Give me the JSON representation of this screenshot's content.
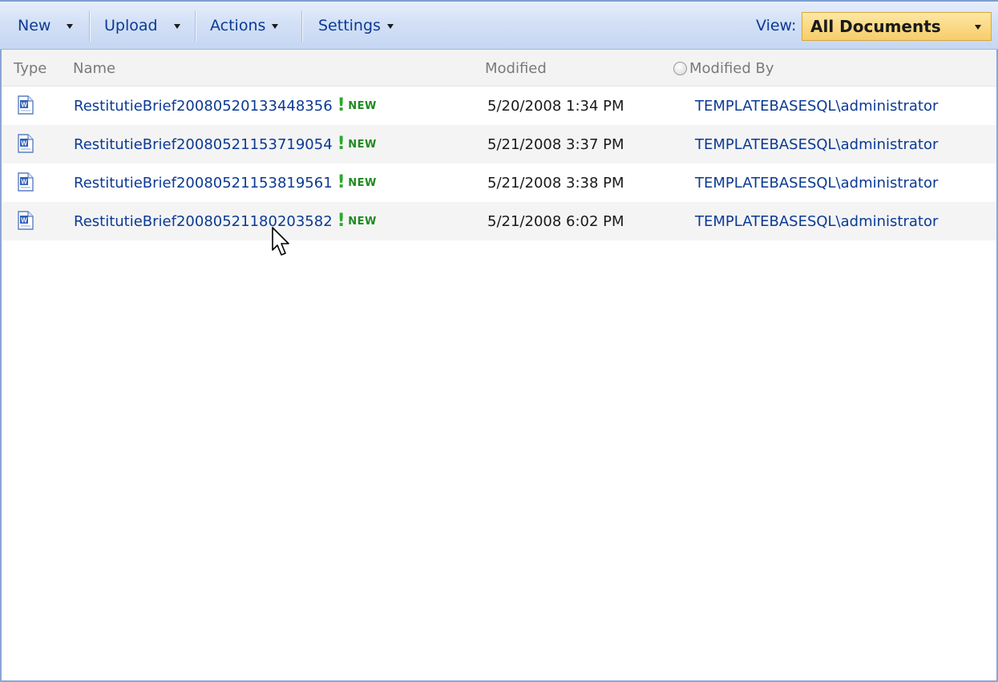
{
  "toolbar": {
    "new_label": "New",
    "upload_label": "Upload",
    "actions_label": "Actions",
    "settings_label": "Settings",
    "view_label": "View:",
    "view_value": "All Documents"
  },
  "columns": {
    "type": "Type",
    "name": "Name",
    "modified": "Modified",
    "modified_by": "Modified By"
  },
  "badge": {
    "new": "NEW"
  },
  "rows": [
    {
      "name": "RestitutieBrief20080520133448356",
      "modified": "5/20/2008 1:34 PM",
      "modified_by": "TEMPLATEBASESQL\\administrator",
      "icon": "word-document-icon"
    },
    {
      "name": "RestitutieBrief20080521153719054",
      "modified": "5/21/2008 3:37 PM",
      "modified_by": "TEMPLATEBASESQL\\administrator",
      "icon": "word-document-icon"
    },
    {
      "name": "RestitutieBrief20080521153819561",
      "modified": "5/21/2008 3:38 PM",
      "modified_by": "TEMPLATEBASESQL\\administrator",
      "icon": "word-document-icon"
    },
    {
      "name": "RestitutieBrief20080521180203582",
      "modified": "5/21/2008 6:02 PM",
      "modified_by": "TEMPLATEBASESQL\\administrator",
      "icon": "word-document-icon"
    }
  ],
  "colors": {
    "toolbar_bg": "#d3e0f6",
    "link": "#0b3a94",
    "view_select": "#f7cd6a",
    "new_badge": "#1f8a1f"
  }
}
